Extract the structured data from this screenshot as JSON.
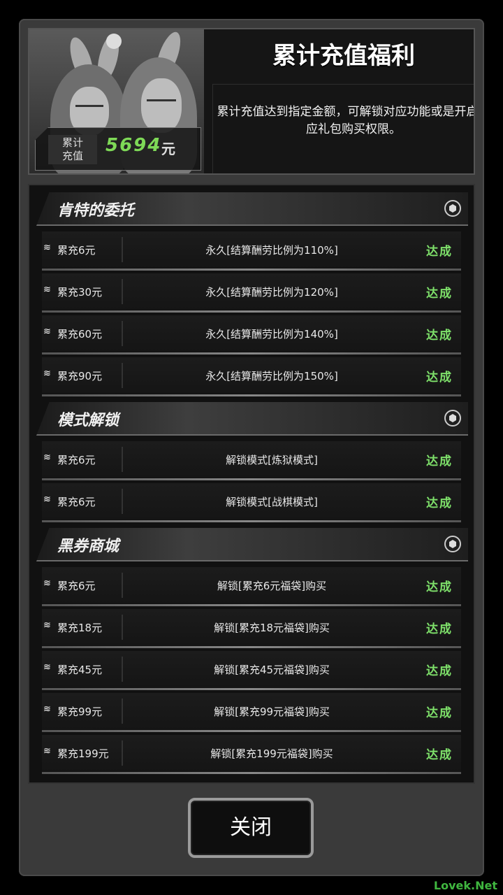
{
  "header": {
    "title": "累计充值福利",
    "description": "累计充值达到指定金额，可解锁对应功能或是开启对应礼包购买权限。",
    "total_label_line1": "累计",
    "total_label_line2": "充值",
    "total_value": "5694",
    "total_unit": "元"
  },
  "sections": [
    {
      "title": "肯特的委托",
      "rows": [
        {
          "amount": "累充6元",
          "desc": "永久[结算酬劳比例为110%]",
          "status": "达成"
        },
        {
          "amount": "累充30元",
          "desc": "永久[结算酬劳比例为120%]",
          "status": "达成"
        },
        {
          "amount": "累充60元",
          "desc": "永久[结算酬劳比例为140%]",
          "status": "达成"
        },
        {
          "amount": "累充90元",
          "desc": "永久[结算酬劳比例为150%]",
          "status": "达成"
        }
      ]
    },
    {
      "title": "模式解锁",
      "rows": [
        {
          "amount": "累充6元",
          "desc": "解锁模式[炼狱模式]",
          "status": "达成"
        },
        {
          "amount": "累充6元",
          "desc": "解锁模式[战棋模式]",
          "status": "达成"
        }
      ]
    },
    {
      "title": "黑券商城",
      "rows": [
        {
          "amount": "累充6元",
          "desc": "解锁[累充6元福袋]购买",
          "status": "达成"
        },
        {
          "amount": "累充18元",
          "desc": "解锁[累充18元福袋]购买",
          "status": "达成"
        },
        {
          "amount": "累充45元",
          "desc": "解锁[累充45元福袋]购买",
          "status": "达成"
        },
        {
          "amount": "累充99元",
          "desc": "解锁[累充99元福袋]购买",
          "status": "达成"
        },
        {
          "amount": "累充199元",
          "desc": "解锁[累充199元福袋]购买",
          "status": "达成"
        }
      ]
    }
  ],
  "close_button": "关闭",
  "watermark": "Lovek.Net",
  "colors": {
    "accent_green": "#7ee06a",
    "value_green": "#7ed957",
    "panel": "#3a3a3a"
  },
  "icons": {
    "row_icon": "layers-icon",
    "section_icon": "hexagon-icon"
  }
}
